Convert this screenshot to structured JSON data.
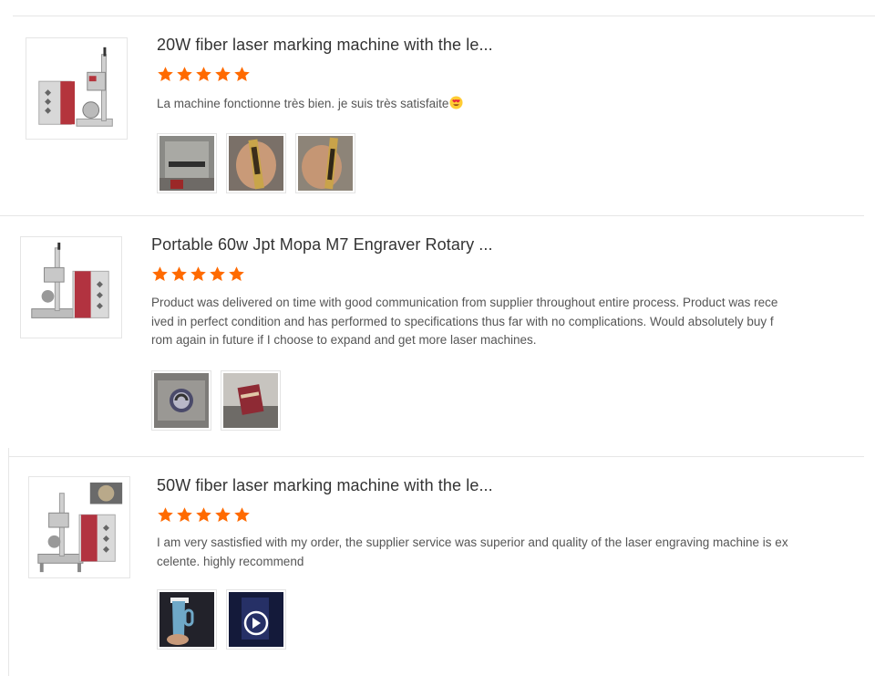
{
  "reviews": [
    {
      "title": "20W fiber laser marking machine with the le...",
      "rating": 5,
      "text": "La machine fonctionne très bien. je suis très satisfaite",
      "emoji_icon": "heart-eyes-emoji-icon",
      "photo_count": 3
    },
    {
      "title": "Portable 60w Jpt Mopa M7 Engraver Rotary ...",
      "rating": 5,
      "text_lines": [
        "Product was delivered on time with good communication from supplier throughout entire process. Product was rece",
        "ived in perfect condition and has performed to specifications thus far with no complications. Would absolutely buy f",
        "rom again in future if I choose to expand and get more laser machines."
      ],
      "photo_count": 2
    },
    {
      "title": "50W fiber laser marking machine with the le...",
      "rating": 5,
      "text_lines": [
        "I am very sastisfied with my order, the supplier service was superior and quality of the laser engraving machine is ex",
        "celente. highly recommend"
      ],
      "photo_count": 2
    }
  ],
  "colors": {
    "star": "#ff6a00",
    "text": "#555555",
    "title": "#333333",
    "divider": "#e6e6e6"
  }
}
